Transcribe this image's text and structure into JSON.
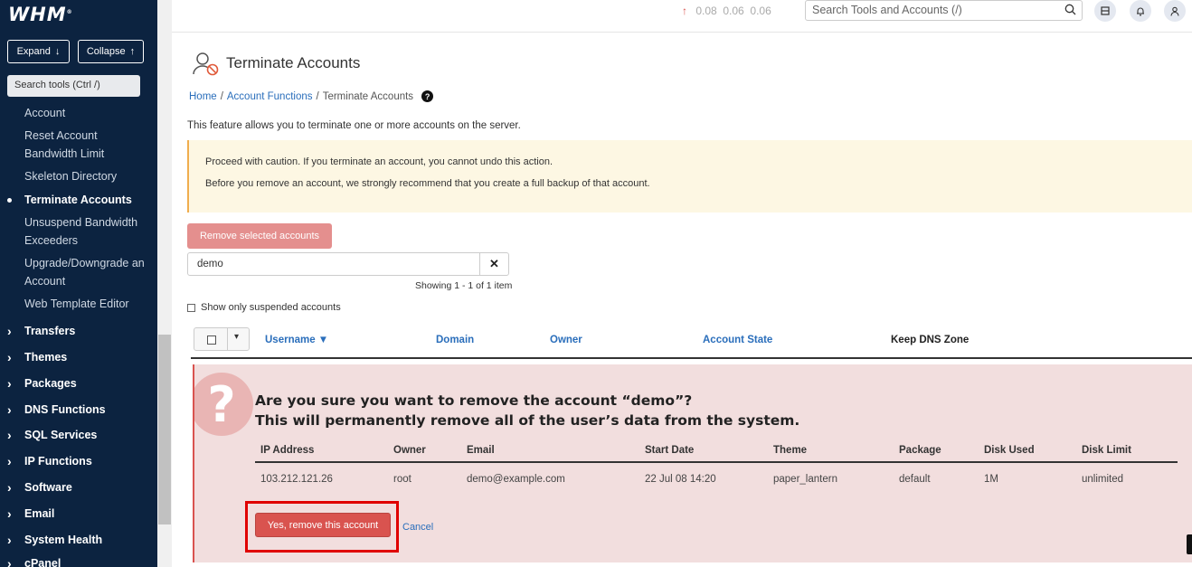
{
  "sidebar": {
    "logo": "WHM",
    "expand_label": "Expand",
    "collapse_label": "Collapse",
    "search_placeholder": "Search tools (Ctrl /)",
    "subitems": [
      {
        "label": "Account",
        "active": false
      },
      {
        "label": "Reset Account Bandwidth Limit",
        "active": false
      },
      {
        "label": "Skeleton Directory",
        "active": false
      },
      {
        "label": "Terminate Accounts",
        "active": true
      },
      {
        "label": "Unsuspend Bandwidth Exceeders",
        "active": false
      },
      {
        "label": "Upgrade/Downgrade an Account",
        "active": false
      },
      {
        "label": "Web Template Editor",
        "active": false
      }
    ],
    "categories": [
      "Transfers",
      "Themes",
      "Packages",
      "DNS Functions",
      "SQL Services",
      "IP Functions",
      "Software",
      "Email",
      "System Health",
      "cPanel"
    ]
  },
  "topbar": {
    "load_averages": [
      "0.08",
      "0.06",
      "0.06"
    ],
    "search_placeholder": "Search Tools and Accounts (/)",
    "icons": [
      "layout-icon",
      "bell-icon",
      "user-icon"
    ]
  },
  "page": {
    "title": "Terminate Accounts",
    "breadcrumbs": [
      "Home",
      "Account Functions",
      "Terminate Accounts"
    ],
    "intro": "This feature allows you to terminate one or more accounts on the server.",
    "warning_line1": "Proceed with caution. If you terminate an account, you cannot undo this action.",
    "warning_line2": "Before you remove an account, we strongly recommend that you create a full backup of that account.",
    "remove_selected_label": "Remove selected accounts",
    "filter_value": "demo",
    "showing_text": "Showing 1 - 1 of 1 item",
    "suspended_only_label": "Show only suspended accounts",
    "columns": [
      "Username ▼",
      "Domain",
      "Owner",
      "Account State",
      "Keep DNS Zone"
    ]
  },
  "confirm": {
    "line1": "Are you sure you want to remove the account “demo”?",
    "line2": "This will permanently remove all of the user’s data from the system.",
    "headers": [
      "IP Address",
      "Owner",
      "Email",
      "Start Date",
      "Theme",
      "Package",
      "Disk Used",
      "Disk Limit"
    ],
    "row": [
      "103.212.121.26",
      "root",
      "demo@example.com",
      "22 Jul 08 14:20",
      "paper_lantern",
      "default",
      "1M",
      "unlimited"
    ],
    "yes_label": "Yes, remove this account",
    "cancel_label": "Cancel"
  },
  "colors": {
    "sidebar_bg": "#0c2340",
    "link": "#2a6ebb",
    "danger": "#d9534f",
    "warning_bg": "#fdf7e3",
    "confirm_bg": "#f2dede"
  }
}
